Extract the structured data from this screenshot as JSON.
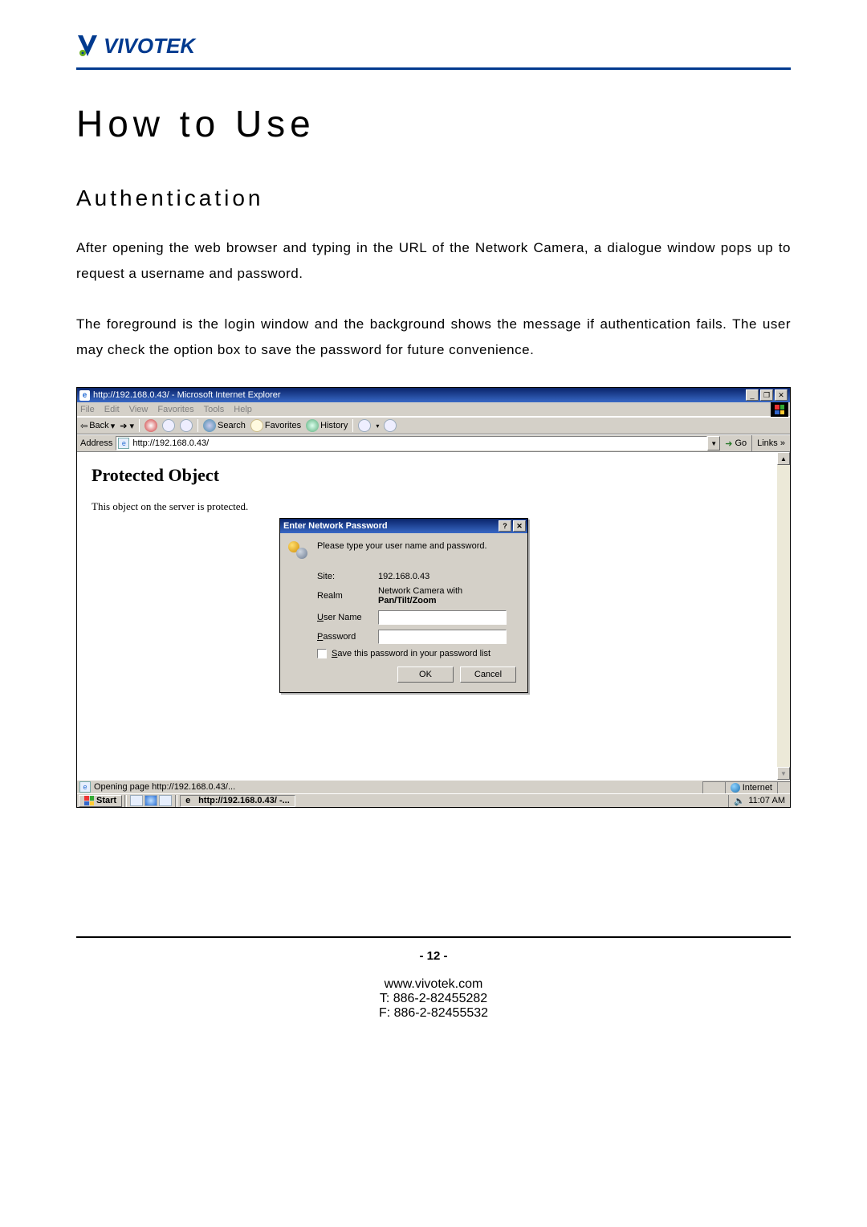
{
  "brand": {
    "name": "VIVOTEK"
  },
  "headings": {
    "h1": "How to Use",
    "h2": "Authentication"
  },
  "paragraphs": {
    "p1": "After opening the web browser and typing in the URL of the Network Camera, a dialogue window pops up to request a username and password.",
    "p2": "The foreground is the login window and the background shows the message if authentication fails. The user may check the option box to save the password for future convenience."
  },
  "ie": {
    "title": "http://192.168.0.43/ - Microsoft Internet Explorer",
    "menus": [
      "File",
      "Edit",
      "View",
      "Favorites",
      "Tools",
      "Help"
    ],
    "toolbar": {
      "back": "Back",
      "search": "Search",
      "favorites": "Favorites",
      "history": "History"
    },
    "address_label": "Address",
    "address_value": "http://192.168.0.43/",
    "go": "Go",
    "links": "Links",
    "page": {
      "heading": "Protected Object",
      "sub": "This object on the server is protected."
    },
    "status": {
      "text": "Opening page http://192.168.0.43/...",
      "zone": "Internet"
    },
    "taskbar": {
      "start": "Start",
      "app": "http://192.168.0.43/ -...",
      "clock": "11:07 AM"
    }
  },
  "dialog": {
    "title": "Enter Network Password",
    "prompt": "Please type your user name and password.",
    "labels": {
      "site": "Site:",
      "realm": "Realm",
      "username": "User Name",
      "password": "Password"
    },
    "values": {
      "site": "192.168.0.43",
      "realm_prefix": "Network Camera with ",
      "realm_bold": "Pan/Tilt/Zoom"
    },
    "save_label": "Save this password in your password list",
    "ok": "OK",
    "cancel": "Cancel"
  },
  "footer": {
    "page": "- 12 -",
    "url": "www.vivotek.com",
    "tel": "T: 886-2-82455282",
    "fax": "F: 886-2-82455532"
  }
}
